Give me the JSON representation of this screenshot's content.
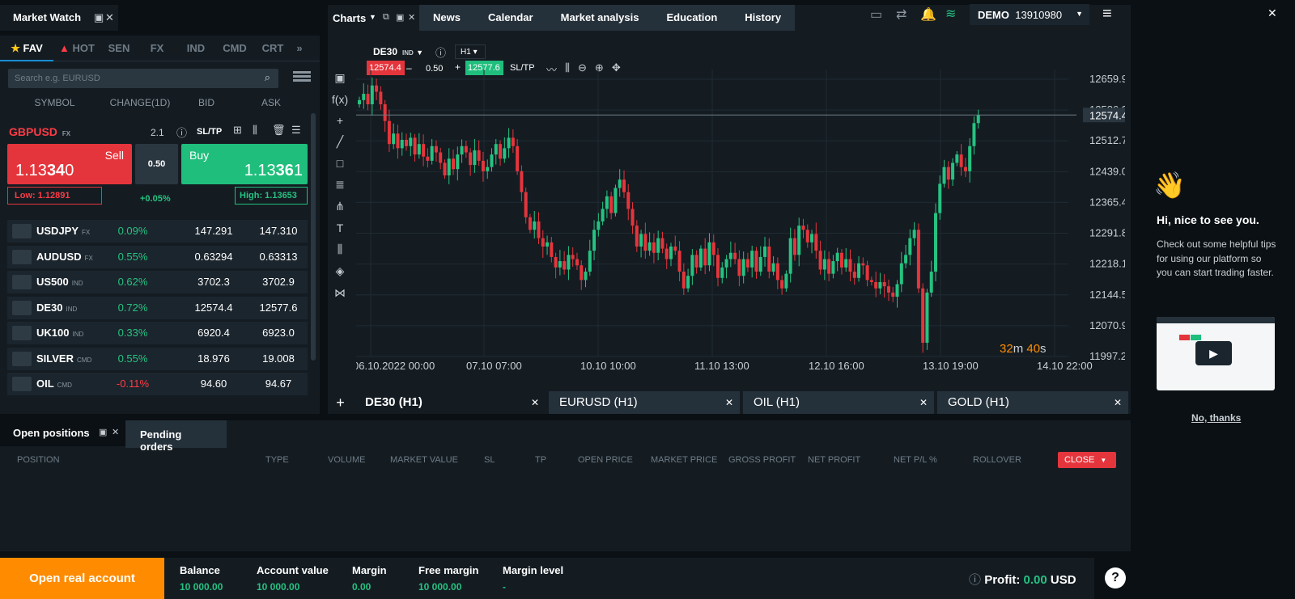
{
  "market_watch": {
    "title": "Market Watch",
    "categories": [
      "FAV",
      "HOT",
      "SEN",
      "FX",
      "IND",
      "CMD",
      "CRT"
    ],
    "search_placeholder": "Search e.g. EURUSD",
    "columns": [
      "SYMBOL",
      "CHANGE(1D)",
      "BID",
      "ASK"
    ],
    "selected": {
      "symbol": "GBPUSD",
      "class": "FX",
      "spread": "2.1",
      "sltp": "SL/TP",
      "sell_label": "Sell",
      "sell_price_a": "1.13",
      "sell_price_b": "34",
      "sell_price_c": "0",
      "buy_label": "Buy",
      "buy_price_a": "1.13",
      "buy_price_b": "36",
      "buy_price_c": "1",
      "volume": "0.50",
      "low": "Low: 1.12891",
      "high": "High: 1.13653",
      "change": "+0.05%"
    },
    "rows": [
      {
        "symbol": "USDJPY",
        "class": "FX",
        "change": "0.09%",
        "bid": "147.291",
        "ask": "147.310",
        "dir": "up"
      },
      {
        "symbol": "AUDUSD",
        "class": "FX",
        "change": "0.55%",
        "bid": "0.63294",
        "ask": "0.63313",
        "dir": "up"
      },
      {
        "symbol": "US500",
        "class": "IND",
        "change": "0.62%",
        "bid": "3702.3",
        "ask": "3702.9",
        "dir": "up"
      },
      {
        "symbol": "DE30",
        "class": "IND",
        "change": "0.72%",
        "bid": "12574.4",
        "ask": "12577.6",
        "dir": "up"
      },
      {
        "symbol": "UK100",
        "class": "IND",
        "change": "0.33%",
        "bid": "6920.4",
        "ask": "6923.0",
        "dir": "up"
      },
      {
        "symbol": "SILVER",
        "class": "CMD",
        "change": "0.55%",
        "bid": "18.976",
        "ask": "19.008",
        "dir": "up"
      },
      {
        "symbol": "OIL",
        "class": "CMD",
        "change": "-0.11%",
        "bid": "94.60",
        "ask": "94.67",
        "dir": "down"
      }
    ]
  },
  "charts_header": {
    "charts_label": "Charts",
    "tabs": [
      "News",
      "Calendar",
      "Market analysis",
      "Education",
      "History"
    ],
    "account_mode": "DEMO",
    "account_number": "13910980"
  },
  "chart_toolbar": {
    "symbol": "DE30",
    "class": "IND",
    "interval": "H1",
    "sell_price": "12574.4",
    "volume": "0.50",
    "buy_price": "12577.6",
    "sltp": "SL/TP"
  },
  "chart_data": {
    "type": "candlestick",
    "y_ticks": [
      "12659.9",
      "12586.3",
      "12512.7",
      "12439.0",
      "12365.4",
      "12291.8",
      "12218.1",
      "12144.5",
      "12070.9",
      "11997.2"
    ],
    "ylim": [
      11997.2,
      12659.9
    ],
    "x_ticks": [
      "06.10.2022 00:00",
      "07.10 07:00",
      "10.10 10:00",
      "11.10 13:00",
      "12.10 16:00",
      "13.10 19:00",
      "14.10 22:00"
    ],
    "current_price": "12574.4",
    "countdown_a": "32",
    "countdown_b": "m ",
    "countdown_c": "40",
    "countdown_d": "s",
    "closes": [
      12610,
      12625,
      12600,
      12645,
      12630,
      12600,
      12560,
      12505,
      12530,
      12495,
      12515,
      12500,
      12520,
      12480,
      12505,
      12475,
      12465,
      12500,
      12485,
      12460,
      12430,
      12470,
      12445,
      12480,
      12500,
      12485,
      12455,
      12490,
      12465,
      12440,
      12450,
      12480,
      12505,
      12470,
      12495,
      12520,
      12500,
      12440,
      12390,
      12330,
      12300,
      12320,
      12280,
      12260,
      12270,
      12235,
      12210,
      12225,
      12205,
      12240,
      12230,
      12215,
      12180,
      12200,
      12250,
      12300,
      12320,
      12350,
      12380,
      12340,
      12400,
      12420,
      12390,
      12350,
      12310,
      12260,
      12290,
      12250,
      12270,
      12245,
      12280,
      12255,
      12230,
      12260,
      12250,
      12200,
      12160,
      12190,
      12240,
      12210,
      12255,
      12215,
      12270,
      12240,
      12185,
      12210,
      12230,
      12245,
      12230,
      12190,
      12230,
      12210,
      12250,
      12200,
      12235,
      12260,
      12200,
      12220,
      12180,
      12160,
      12195,
      12280,
      12240,
      12310,
      12300,
      12270,
      12290,
      12250,
      12205,
      12230,
      12195,
      12225,
      12245,
      12210,
      12230,
      12200,
      12185,
      12220,
      12215,
      12180,
      12175,
      12160,
      12175,
      12165,
      12150,
      12140,
      12170,
      12220,
      12240,
      12280,
      12300,
      12160,
      12030,
      12150,
      12200,
      12340,
      12410,
      12450,
      12420,
      12460,
      12480,
      12450,
      12440,
      12500,
      12555,
      12574
    ]
  },
  "chart_tabs": [
    "DE30 (H1)",
    "EURUSD (H1)",
    "OIL (H1)",
    "GOLD (H1)"
  ],
  "positions": {
    "tabs": [
      "Open positions",
      "Pending orders"
    ],
    "columns": [
      "POSITION",
      "TYPE",
      "VOLUME",
      "MARKET VALUE",
      "SL",
      "TP",
      "OPEN PRICE",
      "MARKET PRICE",
      "GROSS PROFIT",
      "NET PROFIT",
      "NET P/L %",
      "ROLLOVER"
    ],
    "close_label": "CLOSE"
  },
  "status_bar": {
    "open_account": "Open real account",
    "items": [
      {
        "label": "Balance",
        "value": "10 000.00"
      },
      {
        "label": "Account value",
        "value": "10 000.00"
      },
      {
        "label": "Margin",
        "value": "0.00"
      },
      {
        "label": "Free margin",
        "value": "10 000.00"
      },
      {
        "label": "Margin level",
        "value": "-"
      }
    ],
    "profit_label": "Profit:",
    "profit_value": "0.00",
    "currency": "USD"
  },
  "welcome": {
    "emoji": "👋",
    "title": "Hi, nice to see you.",
    "text": "Check out some helpful tips for using our platform so you can start trading faster.",
    "dismiss": "No, thanks"
  },
  "colors": {
    "accent": "#1a8dd4",
    "buy": "#1fbe7c",
    "sell": "#e5353c",
    "orange": "#ff8c00"
  }
}
